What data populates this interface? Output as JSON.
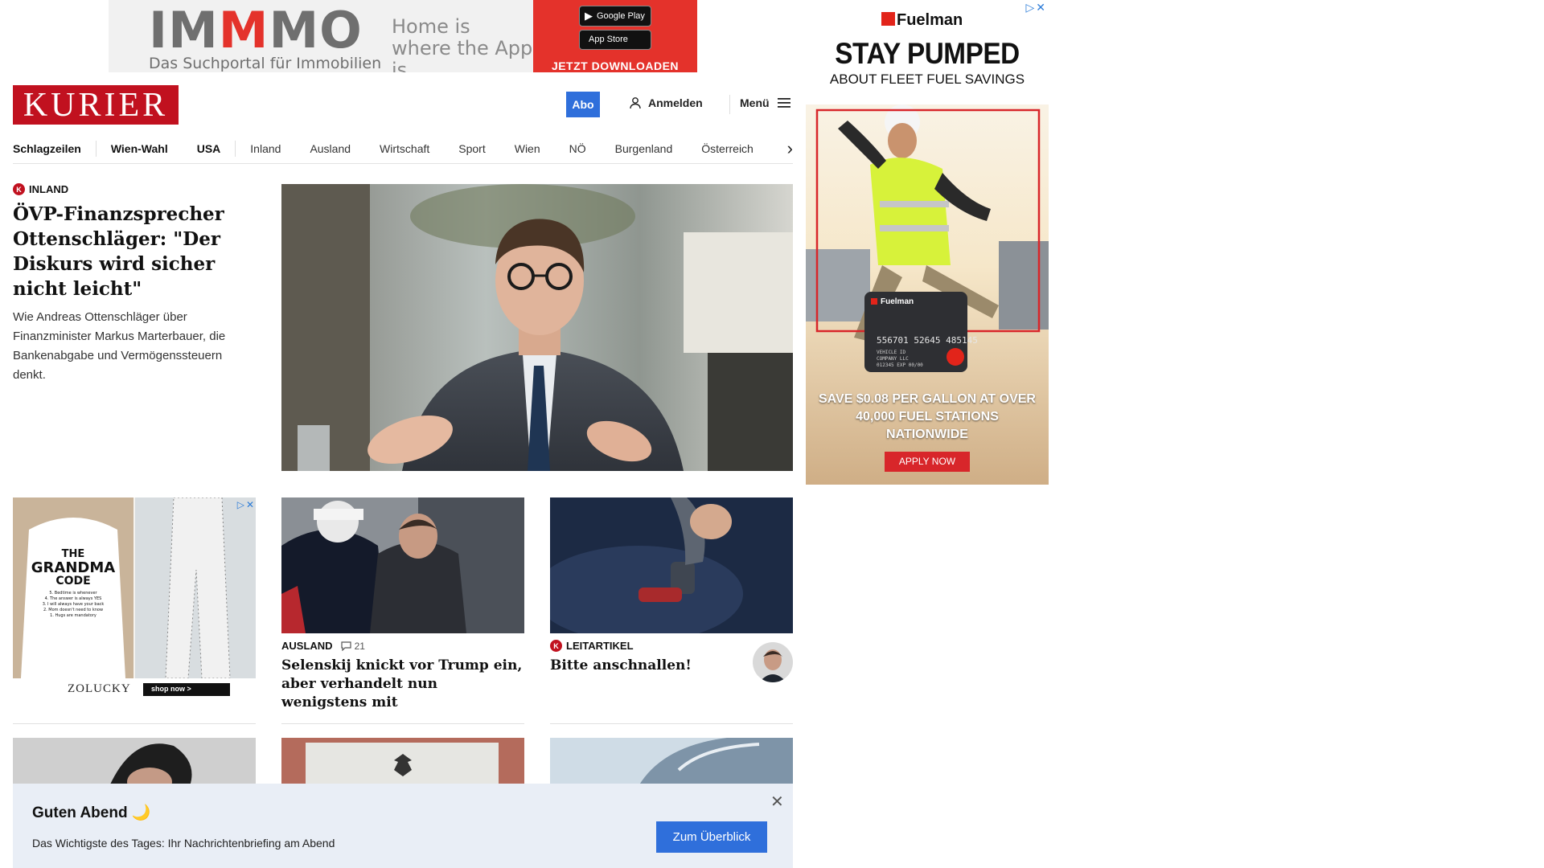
{
  "top_ad": {
    "brand": "IMMMO",
    "tagline": "Das Suchportal für Immobilien",
    "slogan": "Home is where the App is.",
    "google_play_small": "JETZT BEI",
    "google_play": "Google Play",
    "app_store_small": "Laden im",
    "app_store": "App Store",
    "cta": "JETZT DOWNLOADEN"
  },
  "header": {
    "logo": "KURIER",
    "abo_label": "Abo",
    "login_label": "Anmelden",
    "menu_label": "Menü"
  },
  "nav": {
    "items": [
      "Schlagzeilen",
      "Wien-Wahl",
      "USA",
      "Inland",
      "Ausland",
      "Wirtschaft",
      "Sport",
      "Wien",
      "NÖ",
      "Burgenland",
      "Österreich"
    ]
  },
  "lead": {
    "kicker": "INLAND",
    "title": "ÖVP-Finanzsprecher Ottenschläger: \"Der Diskurs wird sicher nicht leicht\"",
    "teaser": "Wie Andreas Ottenschläger über Finanzminister Markus Marterbauer, die Bankenabgabe und Vermögenssteuern denkt."
  },
  "cards": [
    {
      "kicker": "AUSLAND",
      "comments": "21",
      "title": "Selenskij knickt vor Trump ein, aber verhandelt nun wenigstens mit"
    },
    {
      "kicker": "LEITARTIKEL",
      "title": "Bitte anschnallen!"
    }
  ],
  "grid_ad": {
    "headline_1": "THE",
    "headline_2": "GRANDMA",
    "headline_3": "CODE",
    "rules": [
      "5. Bedtime is whenever",
      "4. The answer is always YES",
      "3. I will always have your back",
      "2. Mom doesn't need to know",
      "1. Hugs are mandatory"
    ],
    "brand": "ZOLUCKY",
    "cta": "shop now >"
  },
  "side_ad": {
    "brand": "Fuelman",
    "headline": "STAY PUMPED",
    "subhead": "ABOUT FLEET FUEL SAVINGS",
    "card_brand": "Fuelman",
    "card_number": "556701 52645 485145",
    "card_line_1": "VEHICLE ID",
    "card_line_2": "COMPANY LLC",
    "card_line_3": "012345      EXP 00/00",
    "offer": "SAVE $0.08 PER GALLON AT OVER 40,000 FUEL STATIONS NATIONWIDE",
    "cta": "APPLY NOW"
  },
  "briefing": {
    "title": "Guten Abend 🌙",
    "text": "Das Wichtigste des Tages: Ihr Nachrichtenbriefing am Abend",
    "button": "Zum Überblick"
  },
  "colors": {
    "brand_red": "#c1111f",
    "accent_blue": "#2f6fdb",
    "briefing_bg": "#e9eef6"
  }
}
